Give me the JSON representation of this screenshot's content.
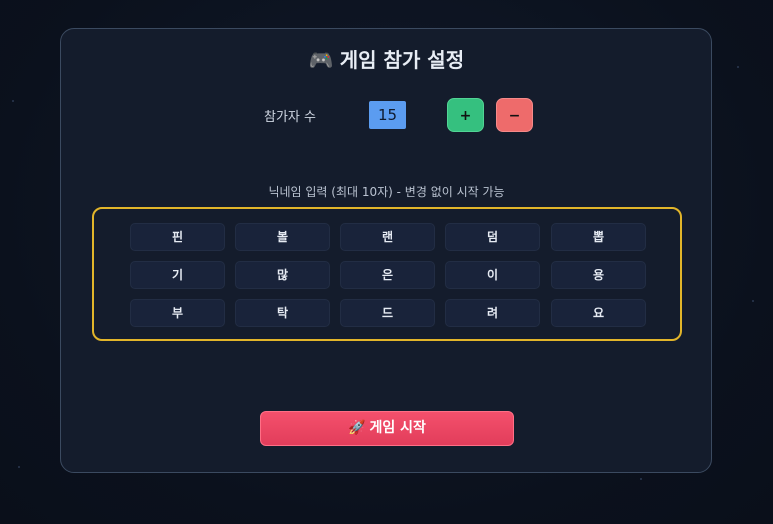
{
  "title": {
    "icon": "gamepad-icon",
    "icon_glyph": "🎮",
    "text": "게임 참가 설정"
  },
  "participants": {
    "label": "참가자 수",
    "value": "15",
    "plus_label": "+",
    "minus_label": "−"
  },
  "nickname": {
    "label": "닉네임 입력 (최대 10자) - 변경 없이 시작 가능",
    "cells": [
      "핀",
      "볼",
      "랜",
      "덤",
      "뽑",
      "기",
      "많",
      "은",
      "이",
      "용",
      "부",
      "탁",
      "드",
      "려",
      "요"
    ]
  },
  "start_button": {
    "icon": "rocket-icon",
    "icon_glyph": "🚀",
    "label": "게임 시작"
  },
  "colors": {
    "background": "#0c1220",
    "panel": "#141c2c",
    "count_box": "#5b9cf0",
    "plus": "#35c07f",
    "minus": "#ee6b6b",
    "grid_border": "#e2b52a",
    "start": "#e23d5b"
  }
}
